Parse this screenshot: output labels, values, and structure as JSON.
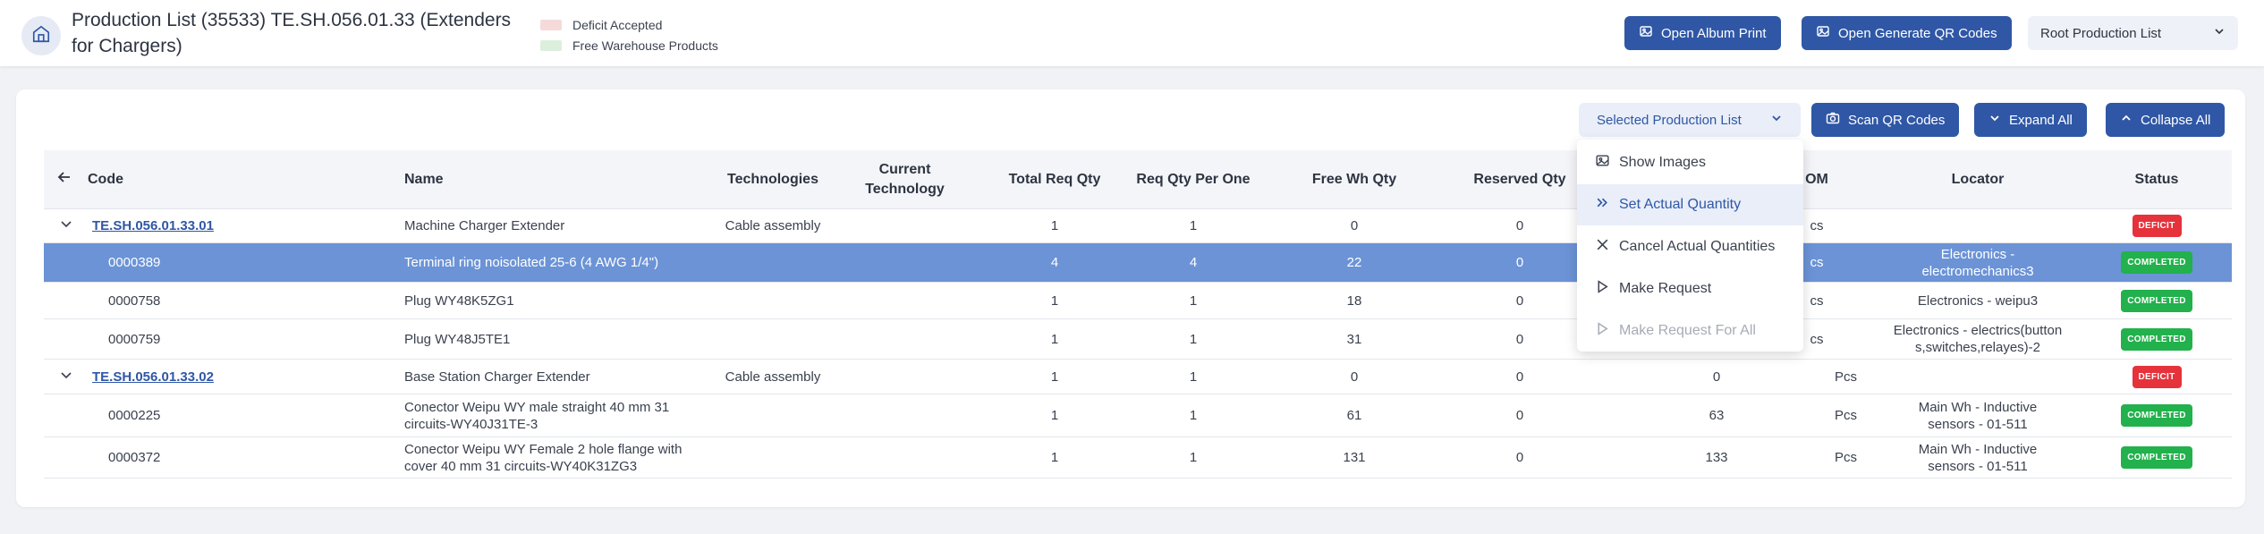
{
  "header": {
    "title": "Production List (35533) TE.SH.056.01.33 (Extenders for Chargers)",
    "legend": [
      {
        "label": "Deficit Accepted",
        "color": "#f6dada"
      },
      {
        "label": "Free Warehouse Products",
        "color": "#dcefdc"
      }
    ],
    "open_album_print": "Open Album Print",
    "open_generate_qr": "Open Generate QR Codes",
    "root_production_list": "Root Production List"
  },
  "toolbar": {
    "selected_production_list": "Selected Production List",
    "scan_qr_codes": "Scan QR Codes",
    "expand_all": "Expand All",
    "collapse_all": "Collapse All"
  },
  "columns": {
    "code": "Code",
    "name": "Name",
    "technologies": "Technologies",
    "current_technology": "Current Technology",
    "total_req_qty": "Total Req Qty",
    "req_qty_per_one": "Req Qty Per One",
    "free_wh_qty": "Free Wh Qty",
    "reserved_qty": "Reserved Qty",
    "uom_partial": "OM",
    "locator": "Locator",
    "status": "Status"
  },
  "rows": [
    {
      "code": "TE.SH.056.01.33.01",
      "name": "Machine Charger Extender",
      "tech": "Cable assembly",
      "total": "1",
      "perone": "1",
      "free": "0",
      "reserved": "0",
      "avail": "",
      "uom": "cs",
      "locator": "",
      "status": "DEFICIT"
    },
    {
      "code": "0000389",
      "name": "Terminal ring noisolated 25-6 (4 AWG 1/4\")",
      "tech": "",
      "total": "4",
      "perone": "4",
      "free": "22",
      "reserved": "0",
      "avail": "",
      "uom": "cs",
      "locator": "Electronics - electromechanics3",
      "status": "COMPLETED"
    },
    {
      "code": "0000758",
      "name": "Plug WY48K5ZG1",
      "tech": "",
      "total": "1",
      "perone": "1",
      "free": "18",
      "reserved": "0",
      "avail": "",
      "uom": "cs",
      "locator": "Electronics - weipu3",
      "status": "COMPLETED"
    },
    {
      "code": "0000759",
      "name": "Plug WY48J5TE1",
      "tech": "",
      "total": "1",
      "perone": "1",
      "free": "31",
      "reserved": "0",
      "avail": "",
      "uom": "cs",
      "locator": "Electronics - electrics(buttons,switches,relayes)-2",
      "status": "COMPLETED"
    },
    {
      "code": "TE.SH.056.01.33.02",
      "name": "Base Station Charger Extender",
      "tech": "Cable assembly",
      "total": "1",
      "perone": "1",
      "free": "0",
      "reserved": "0",
      "avail": "0",
      "uom": "Pcs",
      "locator": "",
      "status": "DEFICIT"
    },
    {
      "code": "0000225",
      "name": "Conector Weipu WY male straight 40 mm 31 circuits-WY40J31TE-3",
      "tech": "",
      "total": "1",
      "perone": "1",
      "free": "61",
      "reserved": "0",
      "avail": "63",
      "uom": "Pcs",
      "locator": "Main Wh - Inductive sensors - 01-511",
      "status": "COMPLETED"
    },
    {
      "code": "0000372",
      "name": "Conector Weipu WY Female 2 hole flange with cover 40 mm 31 circuits-WY40K31ZG3",
      "tech": "",
      "total": "1",
      "perone": "1",
      "free": "131",
      "reserved": "0",
      "avail": "133",
      "uom": "Pcs",
      "locator": "Main Wh - Inductive sensors - 01-511",
      "status": "COMPLETED"
    }
  ],
  "menu": {
    "show_images": "Show Images",
    "set_actual_quantity": "Set Actual Quantity",
    "cancel_actual_quantities": "Cancel Actual Quantities",
    "make_request": "Make Request",
    "make_request_for_all": "Make Request For All"
  },
  "colors": {
    "primary": "#2f57a6",
    "selected_row": "#6b93d6",
    "deficit": "#e5323b",
    "completed": "#22b14c"
  }
}
